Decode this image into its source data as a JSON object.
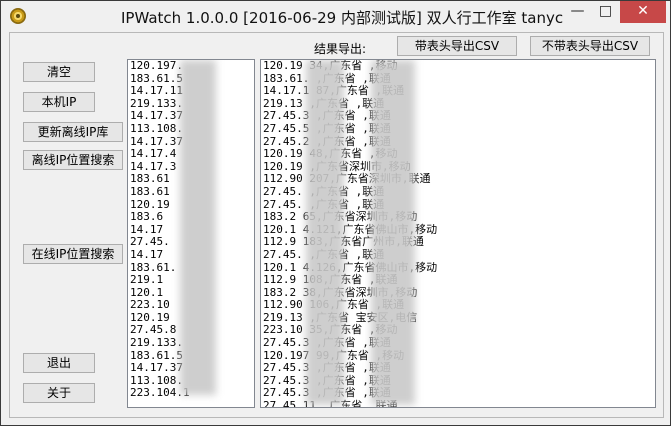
{
  "window": {
    "title": "IPWatch 1.0.0.0 [2016-06-29 内部测试版] 双人行工作室 tanyc",
    "minimize_glyph": "—",
    "maximize_glyph": "□",
    "close_glyph": "✕",
    "app_icon": "gold-coin-icon"
  },
  "left_buttons": {
    "clear": "清空",
    "local_ip": "本机IP",
    "update_offline_db": "更新离线IP库",
    "offline_search": "离线IP位置搜索",
    "online_search": "在线IP位置搜索",
    "exit": "退出",
    "about": "关于"
  },
  "export": {
    "label": "结果导出:",
    "with_header": "带表头导出CSV",
    "without_header": "不带表头导出CSV"
  },
  "ip_list": [
    "120.197.",
    "183.61.5",
    "14.17.11",
    "219.133.",
    "14.17.37",
    "113.108.",
    "14.17.37",
    "14.17.4",
    "14.17.3",
    "183.61",
    "183.61",
    "120.19",
    "183.6",
    "14.17",
    "27.45.",
    "14.17",
    "183.61.",
    "219.1",
    "120.1",
    "223.10",
    "120.19",
    "27.45.8",
    "219.133.",
    "183.61.5",
    "14.17.37",
    "113.108.",
    "223.104.1"
  ],
  "results": [
    "120.19    34,广东省    ,移动",
    "183.61.    ,广东省    ,联通",
    "14.17.1    87,广东省    ,联通",
    "219.13    ,广东省    ,联通",
    "27.45.3    ,广东省    ,联通",
    "27.45.5    ,广东省    ,联通",
    "27.45.2    ,广东省    ,联通",
    "120.19    48,广东省    ,移动",
    "120.19    ,广东省深圳市,移动",
    "112.90    207,广东省深圳市,联通",
    "27.45.    ,广东省    ,联通",
    "27.45.    ,广东省    ,联通",
    "183.2    65,广东省深圳市,移动",
    "120.1    4.121,广东省佛山市,移动",
    "112.9    183,广东省广州市,联通",
    "27.45.    ,广东省    ,联通",
    "120.1    4.126,广东省佛山市,移动",
    "112.9    108,广东省    ,联通",
    "183.2    38,广东省深圳市,移动",
    "112.90    106,广东省    ,联通",
    "219.13    ,广东省    宝安区,电信",
    "223.10    35,广东省    ,移动",
    "27.45.3    ,广东省    ,联通",
    "120.197    99,广东省    ,移动",
    "27.45.3    ,广东省    ,联通",
    "27.45.3    ,广东省    ,联通",
    "27.45.3    ,广东省    ,联通",
    "27.45.11    ,广东省    ,联通"
  ]
}
